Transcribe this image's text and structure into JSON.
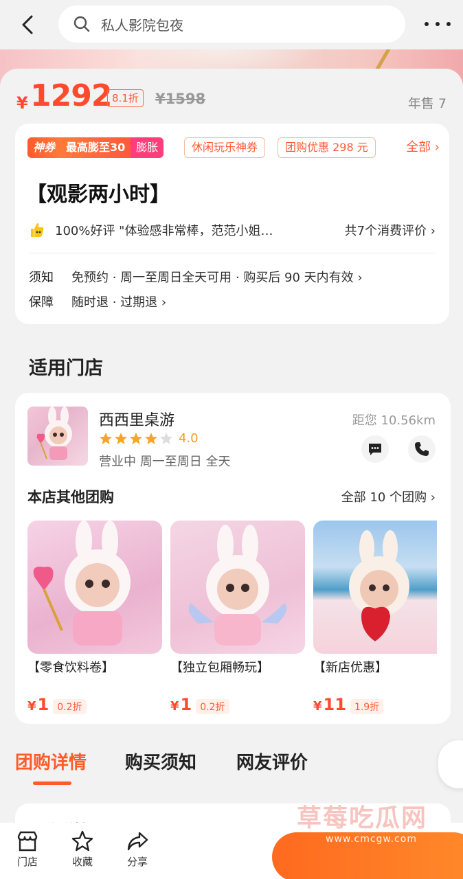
{
  "header": {
    "search_placeholder": "私人影院包夜"
  },
  "price": {
    "symbol": "¥",
    "value": "1292",
    "discount": "8.1折",
    "original": "¥1598",
    "sales": "年售 7"
  },
  "coupons": {
    "main_tag": "神券",
    "main_text": "最高膨至30",
    "expand": "膨胀",
    "tag_leisure": "休闲玩乐神券",
    "tag_group": "团购优惠 298 元",
    "all": "全部 ›"
  },
  "deal": {
    "title": "【观影两小时】",
    "review_text": "100%好评 \"体验感非常棒，范范小姐…",
    "review_count": "共7个消费评价 ›",
    "notice_label": "须知",
    "notice_text": "免预约 · 周一至周日全天可用 · 购买后 90 天内有效 ›",
    "guarantee_label": "保障",
    "guarantee_text": "随时退 · 过期退 ›"
  },
  "stores": {
    "section_title": "适用门店",
    "name": "西西里桌游",
    "rating": "4.0",
    "rating_value": 4.0,
    "hours": "营业中  周一至周日 全天",
    "distance": "距您 10.56km",
    "other_title": "本店其他团购",
    "other_all": "全部 10 个团购 ›",
    "tiles": [
      {
        "name": "【零食饮料卷】",
        "sym": "¥",
        "price": "1",
        "disc": "0.2折"
      },
      {
        "name": "【独立包厢畅玩】",
        "sym": "¥",
        "price": "1",
        "disc": "0.2折"
      },
      {
        "name": "【新店优惠】",
        "sym": "¥",
        "price": "11",
        "disc": "1.9折"
      }
    ]
  },
  "tabs": {
    "detail": "团购详情",
    "notice": "购买须知",
    "reviews": "网友评价"
  },
  "detail_peek": "团购详情",
  "bottom": {
    "store": "门店",
    "favorite": "收藏",
    "share": "分享"
  },
  "watermark": {
    "text": "草莓吃瓜网",
    "url": "www.cmcgw.com"
  },
  "colors": {
    "accent": "#ff5a2a",
    "price": "#ff4a2d",
    "star": "#f39c12"
  }
}
